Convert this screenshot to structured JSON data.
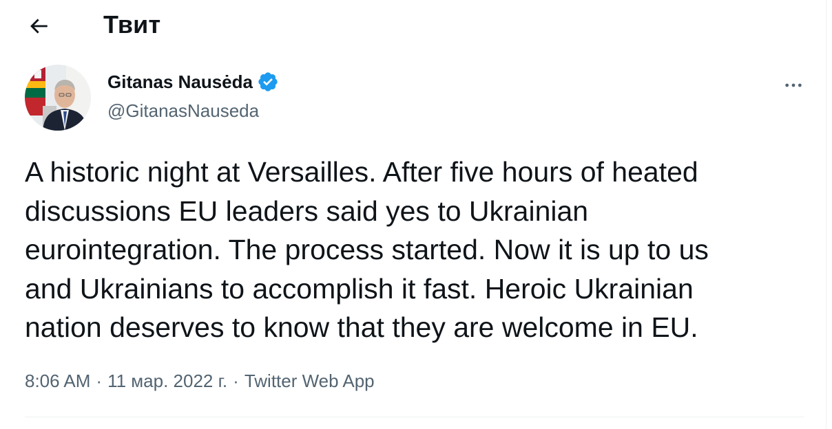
{
  "header": {
    "title": "Твит",
    "back_icon": "arrow-left-icon"
  },
  "author": {
    "display_name": "Gitanas Nausėda",
    "handle": "@GitanasNauseda",
    "verified_icon": "verified-badge-icon",
    "verified_color": "#1d9bf0",
    "more_icon": "more-horizontal-icon"
  },
  "tweet": {
    "text": "A historic night at Versailles. After five hours of heated\ndiscussions EU leaders said yes to Ukrainian\neurointegration. The process started. Now it is up to us\nand Ukrainians to accomplish it fast. Heroic Ukrainian\nnation deserves to know that they are welcome in EU."
  },
  "meta": {
    "time": "8:06 AM",
    "separator": "·",
    "date": "11 мар. 2022 г.",
    "source": "Twitter Web App"
  },
  "colors": {
    "text_primary": "#0f1419",
    "text_secondary": "#536471",
    "border": "#eff3f4",
    "accent": "#1d9bf0"
  }
}
